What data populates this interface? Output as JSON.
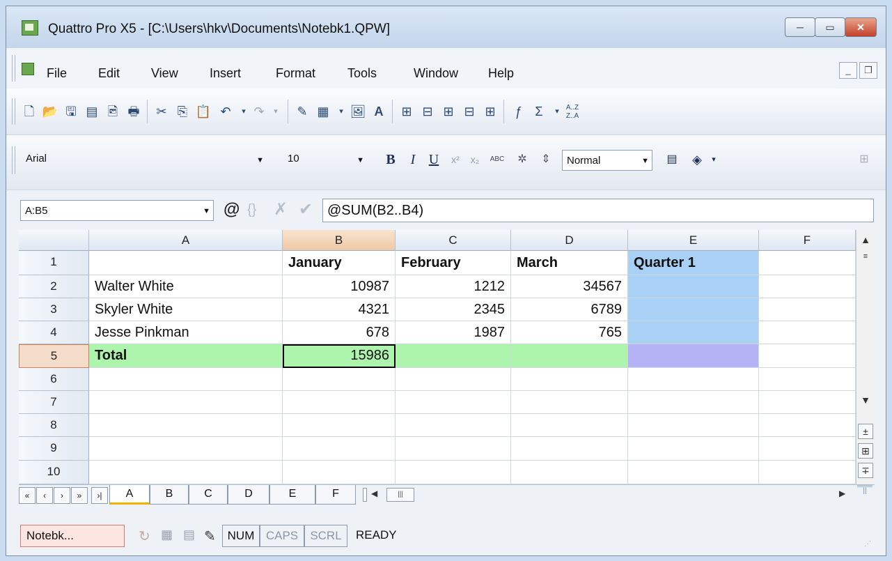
{
  "window": {
    "title": "Quattro Pro X5 - [C:\\Users\\hkv\\Documents\\Notebk1.QPW]",
    "controls": {
      "minimize": "─",
      "maximize": "▭",
      "close": "✕"
    }
  },
  "menu": {
    "items": [
      "File",
      "Edit",
      "View",
      "Insert",
      "Format",
      "Tools",
      "Window",
      "Help"
    ],
    "mdi": {
      "minimize": "_",
      "restore": "❐",
      "close": "✕"
    }
  },
  "toolbar": {
    "icons": [
      "new-icon",
      "open-icon",
      "save-icon",
      "pdf-icon",
      "print-preview-icon",
      "print-icon",
      "cut-icon",
      "copy-icon",
      "paste-icon",
      "undo-icon",
      "redo-icon",
      "format-painter-icon",
      "chart-icon",
      "image-icon",
      "text-box-icon",
      "insert-cells-icon",
      "delete-cells-icon",
      "insert-columns-icon",
      "delete-columns-icon",
      "fit-columns-icon",
      "function-icon",
      "autosum-icon",
      "sort-icon"
    ]
  },
  "format": {
    "font": "Arial",
    "size": "10",
    "bold": "B",
    "italic": "I",
    "underline": "U",
    "style": "Normal"
  },
  "formula": {
    "cell_ref": "A:B5",
    "at_symbol": "@",
    "braces": "{}",
    "cancel": "✗",
    "confirm": "✔",
    "content": "@SUM(B2..B4)"
  },
  "columns": [
    "A",
    "B",
    "C",
    "D",
    "E",
    "F"
  ],
  "rows": [
    "1",
    "2",
    "3",
    "4",
    "5",
    "6",
    "7",
    "8",
    "9",
    "10"
  ],
  "cells": {
    "r1": [
      "",
      "January",
      "February",
      "March",
      "Quarter 1",
      ""
    ],
    "r2": [
      "Walter White",
      "10987",
      "1212",
      "34567",
      "",
      ""
    ],
    "r3": [
      "Skyler White",
      "4321",
      "2345",
      "6789",
      "",
      ""
    ],
    "r4": [
      "Jesse Pinkman",
      "678",
      "1987",
      "765",
      "",
      ""
    ],
    "r5": [
      "Total",
      "15986",
      "",
      "",
      "",
      ""
    ]
  },
  "sheet_nav": [
    "«",
    "‹",
    "›",
    "»",
    "›|"
  ],
  "sheet_tabs": [
    "A",
    "B",
    "C",
    "D",
    "E",
    "F"
  ],
  "status": {
    "notebook": "Notebk...",
    "num": "NUM",
    "caps": "CAPS",
    "scrl": "SCRL",
    "mode": "READY"
  },
  "colors": {
    "header_blue": "#a9d0f5",
    "total_green": "#adf5ad",
    "total_purple": "#b3b3f5",
    "selected_header": "#f4dccb"
  }
}
